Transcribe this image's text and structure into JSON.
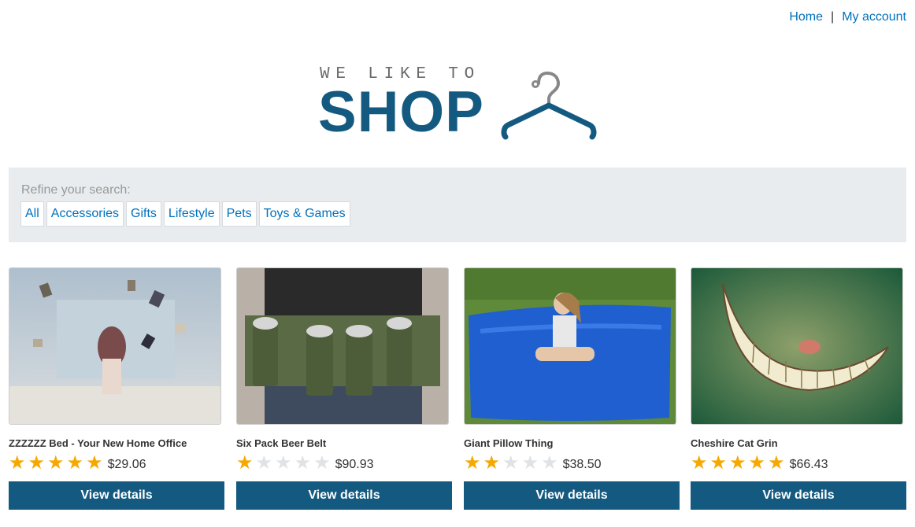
{
  "top_nav": {
    "home": "Home",
    "separator": "|",
    "account": "My account"
  },
  "logo": {
    "tagline": "WE LIKE TO",
    "word": "SHOP",
    "icon": "hanger-icon"
  },
  "filter": {
    "label": "Refine your search:",
    "categories": [
      "All",
      "Accessories",
      "Gifts",
      "Lifestyle",
      "Pets",
      "Toys & Games"
    ]
  },
  "products": [
    {
      "name": "ZZZZZZ Bed - Your New Home Office",
      "rating": 5,
      "price": "$29.06",
      "button": "View details"
    },
    {
      "name": "Six Pack Beer Belt",
      "rating": 1,
      "price": "$90.93",
      "button": "View details"
    },
    {
      "name": "Giant Pillow Thing",
      "rating": 2,
      "price": "$38.50",
      "button": "View details"
    },
    {
      "name": "Cheshire Cat Grin",
      "rating": 5,
      "price": "$66.43",
      "button": "View details"
    }
  ],
  "colors": {
    "link": "#0071bc",
    "brand": "#145a80",
    "star": "#f7a800",
    "filter_bg": "#e8ecef"
  }
}
